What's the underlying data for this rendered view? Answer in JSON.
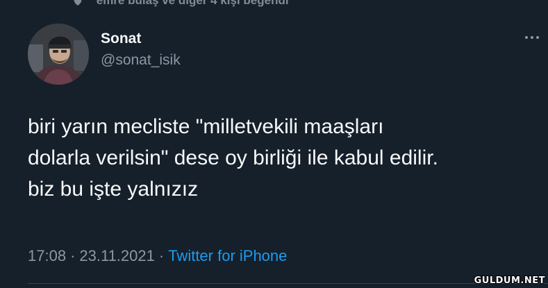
{
  "context": {
    "liked_by_text": "emre bulaş ve diğer 4 kişi beğendi"
  },
  "author": {
    "display_name": "Sonat",
    "handle": "@sonat_isik"
  },
  "tweet": {
    "lines": [
      "biri yarın mecliste \"milletvekili maaşları",
      "dolarla verilsin\" dese oy birliği ile kabul edilir.",
      "biz bu işte yalnızız"
    ],
    "time": "17:08",
    "date": "23.11.2021",
    "separator": "·",
    "source": "Twitter for iPhone"
  },
  "watermark": "GULDUM.NET",
  "colors": {
    "background": "#15202b",
    "primary_text": "#f7f9f9",
    "secondary_text": "#8b98a5",
    "link": "#1d9bf0"
  },
  "icons": {
    "context": "heart-icon",
    "more": "more-icon"
  }
}
